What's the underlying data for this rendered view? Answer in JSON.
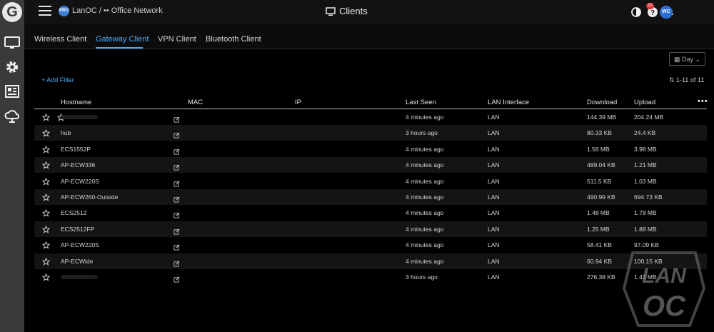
{
  "app": {
    "pro_badge": "PRO",
    "breadcrumb": "LanOC / •• Office Network",
    "page_title": "Clients",
    "notification_count": "22",
    "avatar_initials": "WC",
    "logo_letter": "G"
  },
  "tabs": [
    "Wireless Client",
    "Gateway Client",
    "VPN Client",
    "Bluetooth Client"
  ],
  "toolbar": {
    "day_select": "▦ Day  ⌄",
    "add_filter": "+ Add Filter",
    "pagination": "⇅ 1-11 of 11",
    "more": "•••"
  },
  "table": {
    "columns": [
      "Hostname",
      "MAC",
      "IP",
      "Last Seen",
      "LAN Interface",
      "Download",
      "Upload"
    ],
    "rows": [
      {
        "hostname": "",
        "last_seen": "4 minutes ago",
        "lan": "LAN",
        "download": "144.39 MB",
        "upload": "204.24 MB"
      },
      {
        "hostname": "hub",
        "last_seen": "3 hours ago",
        "lan": "LAN",
        "download": "80.33 KB",
        "upload": "24.4 KB"
      },
      {
        "hostname": "ECS1552P",
        "last_seen": "4 minutes ago",
        "lan": "LAN",
        "download": "1.56 MB",
        "upload": "3.98 MB"
      },
      {
        "hostname": "AP-ECW336",
        "last_seen": "4 minutes ago",
        "lan": "LAN",
        "download": "489.04 KB",
        "upload": "1.21 MB"
      },
      {
        "hostname": "AP-ECW220S",
        "last_seen": "4 minutes ago",
        "lan": "LAN",
        "download": "511.5 KB",
        "upload": "1.03 MB"
      },
      {
        "hostname": "AP-ECW260-Outside",
        "last_seen": "4 minutes ago",
        "lan": "LAN",
        "download": "490.99 KB",
        "upload": "694.73 KB"
      },
      {
        "hostname": "ECS2512",
        "last_seen": "4 minutes ago",
        "lan": "LAN",
        "download": "1.48 MB",
        "upload": "1.78 MB"
      },
      {
        "hostname": "ECS2512FP",
        "last_seen": "4 minutes ago",
        "lan": "LAN",
        "download": "1.25 MB",
        "upload": "1.88 MB"
      },
      {
        "hostname": "AP-ECW220S",
        "last_seen": "4 minutes ago",
        "lan": "LAN",
        "download": "58.41 KB",
        "upload": "97.09 KB"
      },
      {
        "hostname": "AP-ECWide",
        "last_seen": "4 minutes ago",
        "lan": "LAN",
        "download": "60.94 KB",
        "upload": "100.15 KB"
      },
      {
        "hostname": "",
        "last_seen": "3 hours ago",
        "lan": "LAN",
        "download": "276.38 KB",
        "upload": "1.42 MB"
      }
    ]
  },
  "watermark": "LANOC",
  "colors": {
    "accent": "#4da8f0",
    "sidebar": "#3a3a3a",
    "avatar": "#2b6fd6",
    "badge": "#dd3333"
  }
}
